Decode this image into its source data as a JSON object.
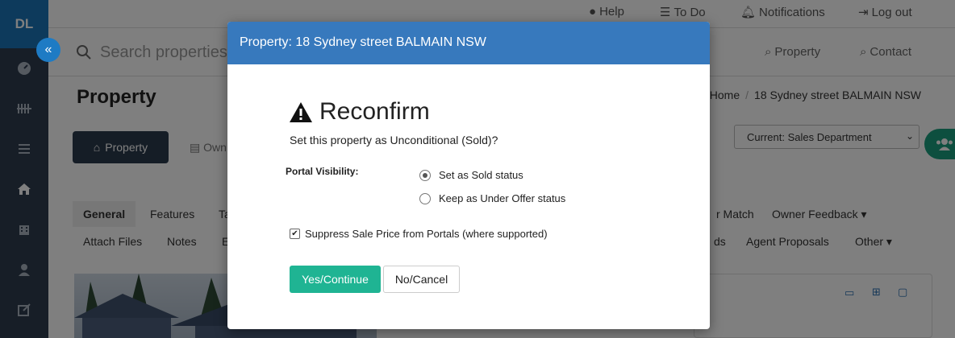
{
  "sidebar": {
    "logo": "DL",
    "collapse_icon": "«",
    "icons": [
      "dashboard-icon",
      "barcode-icon",
      "list-icon",
      "home-icon",
      "building-icon",
      "user-icon",
      "edit-icon"
    ]
  },
  "topbar": {
    "help": "Help",
    "todo": "To Do",
    "notifications": "Notifications",
    "logout": "Log out"
  },
  "search": {
    "placeholder": "Search properties c",
    "property_link": "Property",
    "contact_link": "Contact"
  },
  "page": {
    "title": "Property",
    "breadcrumb": [
      "Home",
      "18 Sydney street BALMAIN NSW"
    ],
    "property_button": "Property",
    "owner_button": "Own",
    "department_select": "Current: Sales Department"
  },
  "tabs_row1": [
    "General",
    "Features",
    "Ta",
    "r Match",
    "Owner Feedback"
  ],
  "tabs_row2": [
    "Attach Files",
    "Notes",
    "E",
    "ds",
    "Agent Proposals",
    "Other"
  ],
  "modal": {
    "header": "Property: 18 Sydney street BALMAIN NSW",
    "title": "Reconfirm",
    "question": "Set this property as Unconditional (Sold)?",
    "portal_label": "Portal Visibility:",
    "option_sold": "Set as Sold status",
    "option_under_offer": "Keep as Under Offer status",
    "suppress_label": "Suppress Sale Price from Portals (where supported)",
    "yes_button": "Yes/Continue",
    "no_button": "No/Cancel"
  },
  "colors": {
    "modal_header": "#3779bd",
    "sidebar": "#2f3d4f",
    "accent_green": "#1fb493",
    "logo_bg": "#1a75b8"
  }
}
